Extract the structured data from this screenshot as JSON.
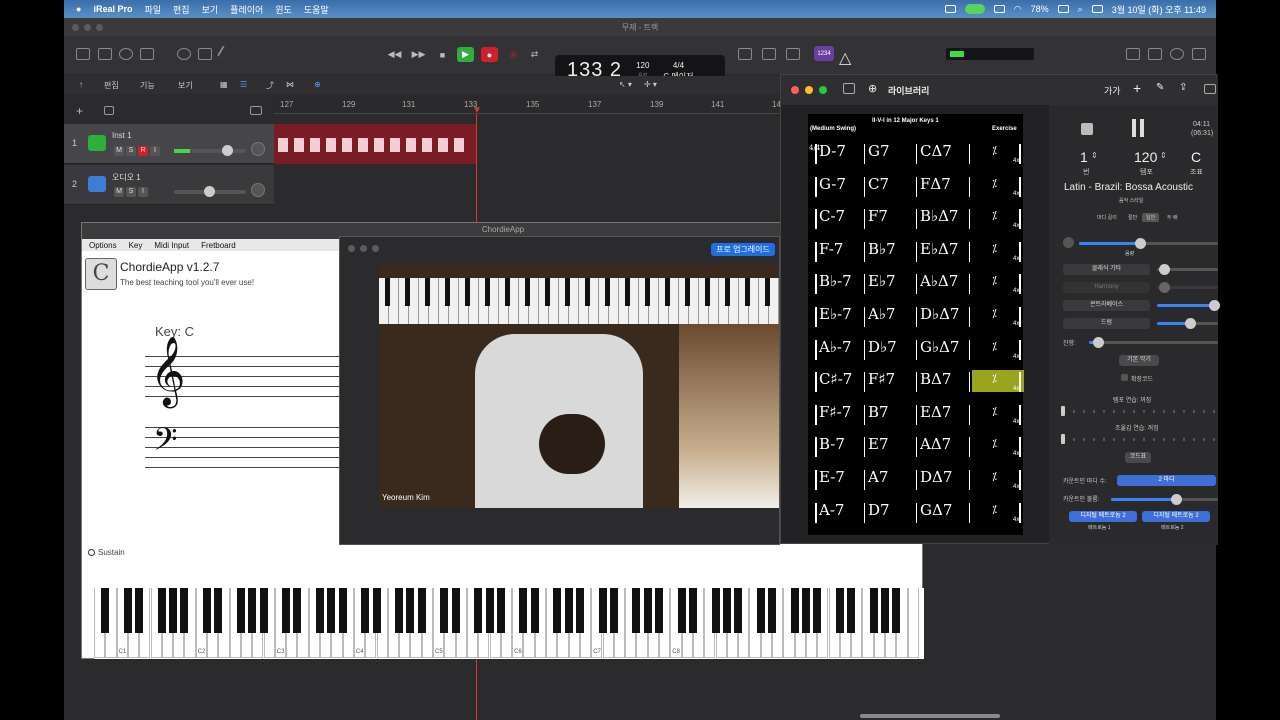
{
  "menubar": {
    "app": "iReal Pro",
    "items": [
      "파일",
      "편집",
      "보기",
      "플레이어",
      "윈도",
      "도움말"
    ],
    "battery": "78%",
    "datetime": "3월 10일 (화) 오후 11:49"
  },
  "logic": {
    "window_title": "무제 - 트랙",
    "lcd": {
      "bars": "133 2",
      "tempo": "120",
      "tempo_sub": "유지",
      "signature": "4/4",
      "key": "C 메이저"
    },
    "tracks_menu": [
      "편집",
      "기능",
      "보기"
    ],
    "ruler": [
      "127",
      "129",
      "131",
      "133",
      "135",
      "137",
      "139",
      "141",
      "14"
    ],
    "tracks": [
      {
        "num": "1",
        "name": "Inst 1",
        "color": "#2fae3b"
      },
      {
        "num": "2",
        "name": "오디오 1",
        "color": "#3a7ed8"
      }
    ],
    "msri": [
      "M",
      "S",
      "R",
      "I"
    ],
    "badge": "1234"
  },
  "chordie": {
    "window_title": "ChordieApp",
    "menu": [
      "Options",
      "Key",
      "Midi Input",
      "Fretboard"
    ],
    "title": "ChordieApp v1.2.7",
    "tagline": "The best teaching tool you'll ever use!",
    "key": "Key: C",
    "sustain": "Sustain",
    "octaves": [
      "C1",
      "C2",
      "C3",
      "C4",
      "C5",
      "C6",
      "C7",
      "C8"
    ]
  },
  "video": {
    "upgrade": "프로 업그레이드",
    "name": "Yeoreum Kim"
  },
  "ireal": {
    "window_title": "라이브러리",
    "top_btn": "가가",
    "sheet": {
      "style": "(Medium Swing)",
      "title": "II-V-I in 12 Major Keys 1",
      "composer": "Exercise",
      "time": "4/4",
      "repeat": "4x",
      "highlighted_row": 7,
      "rows": [
        [
          "D-7",
          "G7",
          "CΔ7"
        ],
        [
          "G-7",
          "C7",
          "FΔ7"
        ],
        [
          "C-7",
          "F7",
          "B♭Δ7"
        ],
        [
          "F-7",
          "B♭7",
          "E♭Δ7"
        ],
        [
          "B♭-7",
          "E♭7",
          "A♭Δ7"
        ],
        [
          "E♭-7",
          "A♭7",
          "D♭Δ7"
        ],
        [
          "A♭-7",
          "D♭7",
          "G♭Δ7"
        ],
        [
          "C♯-7",
          "F♯7",
          "BΔ7"
        ],
        [
          "F♯-7",
          "B7",
          "EΔ7"
        ],
        [
          "B-7",
          "E7",
          "AΔ7"
        ],
        [
          "E-7",
          "A7",
          "DΔ7"
        ],
        [
          "A-7",
          "D7",
          "GΔ7"
        ]
      ]
    },
    "panel": {
      "time": "04:11",
      "total": "(06:31)",
      "repeats": "1",
      "repeats_label": "번",
      "tempo": "120",
      "tempo_label": "템포",
      "key": "C",
      "key_label": "조표",
      "style": "Latin - Brazil: Bossa Acoustic",
      "style_label": "음악 스타일",
      "meter_label": "마디 길이",
      "meter_opts": [
        "절반",
        "일반",
        "두 배"
      ],
      "volume_label": "음량",
      "inst1": "클래식 기타",
      "inst2": "Harmony",
      "inst3": "콘트라베이스",
      "inst4": "드럼",
      "reverb": "잔향:",
      "default_btn": "기본 악기",
      "ext_chords": "확장코드",
      "tempo_practice": "템포 연습: 꺼짐",
      "transpose_practice": "조옮김 연습: 꺼짐",
      "chords_btn": "코드표",
      "countin_bars_label": "카운트인 마디 수:",
      "countin_bars": "2 마디",
      "countin_vol": "카운트인 볼륨:",
      "metro1": "디지털 메트로놈 2",
      "metro2": "디지털 메트로놈 2",
      "metro1_label": "메트로놈 1",
      "metro2_label": "메트로놈 2"
    }
  }
}
